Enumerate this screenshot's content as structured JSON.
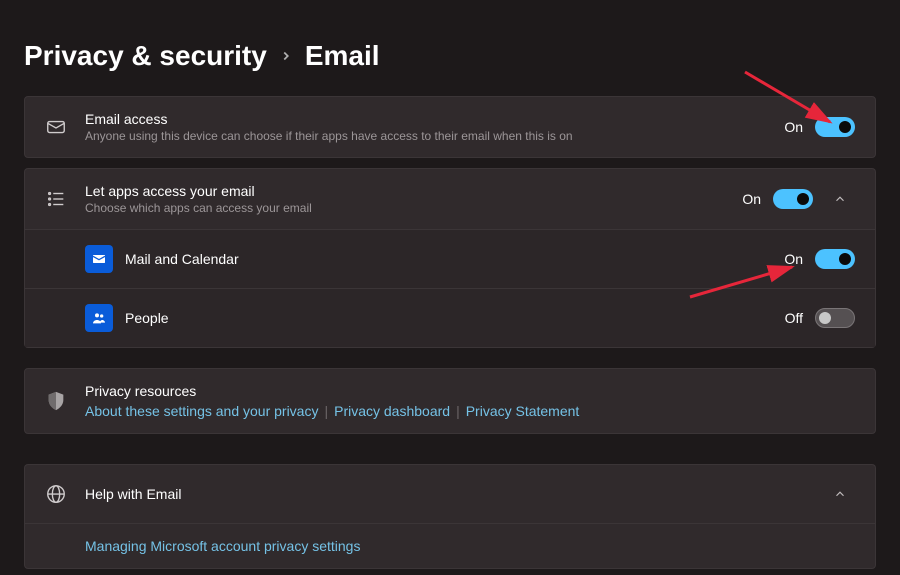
{
  "breadcrumb": {
    "parent": "Privacy & security",
    "current": "Email"
  },
  "email_access": {
    "title": "Email access",
    "desc": "Anyone using this device can choose if their apps have access to their email when this is on",
    "state_label": "On",
    "state": true
  },
  "let_apps": {
    "title": "Let apps access your email",
    "desc": "Choose which apps can access your email",
    "state_label": "On",
    "state": true,
    "expanded": true,
    "apps": [
      {
        "name": "Mail and Calendar",
        "state_label": "On",
        "state": true,
        "icon": "mail"
      },
      {
        "name": "People",
        "state_label": "Off",
        "state": false,
        "icon": "people"
      }
    ]
  },
  "resources": {
    "title": "Privacy resources",
    "links": [
      "About these settings and your privacy",
      "Privacy dashboard",
      "Privacy Statement"
    ]
  },
  "help": {
    "title": "Help with Email",
    "link": "Managing Microsoft account privacy settings",
    "expanded": true
  }
}
